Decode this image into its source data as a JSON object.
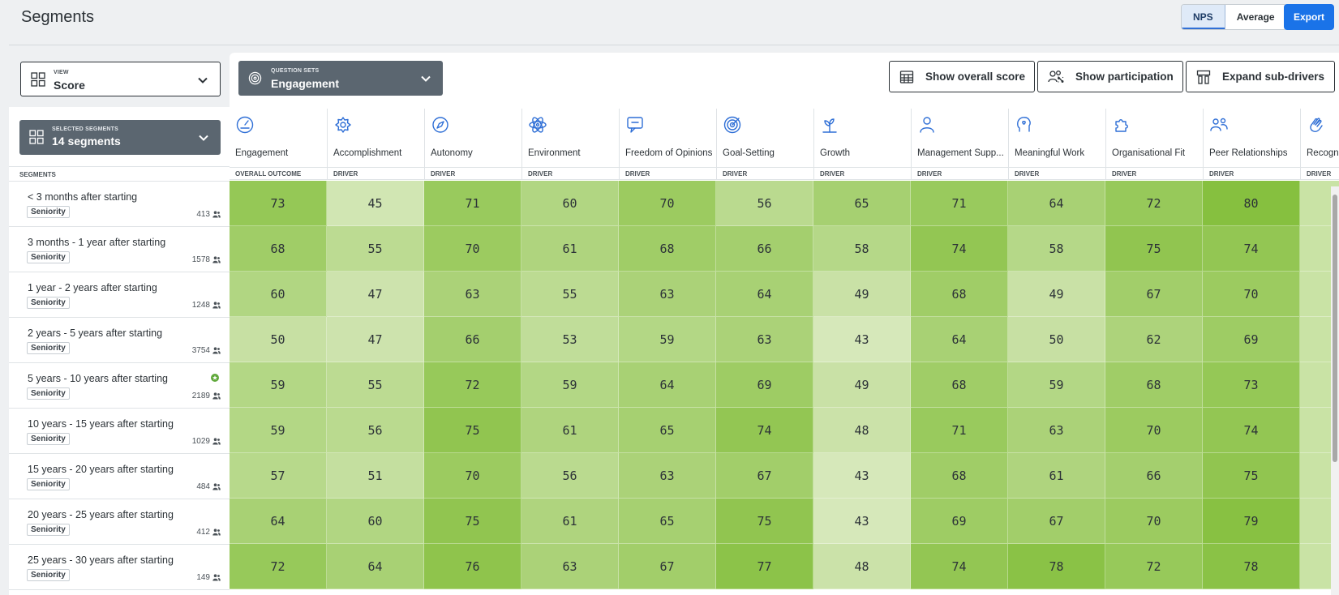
{
  "page": {
    "title": "Segments"
  },
  "mode_toggle": {
    "options": [
      "NPS",
      "Average"
    ],
    "active": "NPS"
  },
  "export": {
    "label": "Export"
  },
  "view": {
    "caption": "VIEW",
    "value": "Score"
  },
  "question_sets": {
    "caption": "QUESTION SETS",
    "value": "Engagement"
  },
  "actions": {
    "overall": "Show overall score",
    "participation": "Show participation",
    "expand": "Expand sub-drivers"
  },
  "selected_segments": {
    "caption": "SELECTED SEGMENTS",
    "value": "14 segments"
  },
  "segments_header": "SEGMENTS",
  "columns": [
    {
      "name": "Engagement",
      "type": "OVERALL OUTCOME",
      "icon": "gauge-icon"
    },
    {
      "name": "Accomplishment",
      "type": "DRIVER",
      "icon": "badge-icon"
    },
    {
      "name": "Autonomy",
      "type": "DRIVER",
      "icon": "compass-icon"
    },
    {
      "name": "Environment",
      "type": "DRIVER",
      "icon": "atom-icon"
    },
    {
      "name": "Freedom of Opinions",
      "type": "DRIVER",
      "icon": "speech-bubble-icon"
    },
    {
      "name": "Goal-Setting",
      "type": "DRIVER",
      "icon": "target-icon"
    },
    {
      "name": "Growth",
      "type": "DRIVER",
      "icon": "plant-icon"
    },
    {
      "name": "Management Supp...",
      "type": "DRIVER",
      "icon": "person-icon"
    },
    {
      "name": "Meaningful Work",
      "type": "DRIVER",
      "icon": "head-heart-icon"
    },
    {
      "name": "Organisational Fit",
      "type": "DRIVER",
      "icon": "puzzle-icon"
    },
    {
      "name": "Peer Relationships",
      "type": "DRIVER",
      "icon": "people-icon"
    },
    {
      "name": "Recogni",
      "type": "DRIVER",
      "icon": "clap-icon"
    }
  ],
  "rows": [
    {
      "name": "< 3 months after starting",
      "tag": "Seniority",
      "count": "413",
      "starred": false,
      "values": [
        73,
        45,
        71,
        60,
        70,
        56,
        65,
        71,
        64,
        72,
        80,
        ""
      ]
    },
    {
      "name": "3 months - 1 year after starting",
      "tag": "Seniority",
      "count": "1578",
      "starred": false,
      "values": [
        68,
        55,
        70,
        61,
        68,
        66,
        58,
        74,
        58,
        75,
        74,
        ""
      ]
    },
    {
      "name": "1 year - 2 years after starting",
      "tag": "Seniority",
      "count": "1248",
      "starred": false,
      "values": [
        60,
        47,
        63,
        55,
        63,
        64,
        49,
        68,
        49,
        67,
        70,
        ""
      ]
    },
    {
      "name": "2 years - 5 years after starting",
      "tag": "Seniority",
      "count": "3754",
      "starred": false,
      "values": [
        50,
        47,
        66,
        53,
        59,
        63,
        43,
        64,
        50,
        62,
        69,
        ""
      ]
    },
    {
      "name": "5 years - 10 years after starting",
      "tag": "Seniority",
      "count": "2189",
      "starred": true,
      "values": [
        59,
        55,
        72,
        59,
        64,
        69,
        49,
        68,
        59,
        68,
        73,
        ""
      ]
    },
    {
      "name": "10 years - 15 years after starting",
      "tag": "Seniority",
      "count": "1029",
      "starred": false,
      "values": [
        59,
        56,
        75,
        61,
        65,
        74,
        48,
        71,
        63,
        70,
        74,
        ""
      ]
    },
    {
      "name": "15 years - 20 years after starting",
      "tag": "Seniority",
      "count": "484",
      "starred": false,
      "values": [
        57,
        51,
        70,
        56,
        63,
        67,
        43,
        68,
        61,
        66,
        75,
        ""
      ]
    },
    {
      "name": "20 years - 25 years after starting",
      "tag": "Seniority",
      "count": "412",
      "starred": false,
      "values": [
        64,
        60,
        75,
        61,
        65,
        75,
        43,
        69,
        67,
        70,
        79,
        ""
      ]
    },
    {
      "name": "25 years - 30 years after starting",
      "tag": "Seniority",
      "count": "149",
      "starred": false,
      "values": [
        72,
        64,
        76,
        63,
        67,
        77,
        48,
        74,
        78,
        72,
        78,
        ""
      ]
    }
  ],
  "colors": {
    "accent": "#1a73e8",
    "dark_select": "#5b6670",
    "heat_low": "#dcebc4",
    "heat_high": "#86c03f"
  }
}
